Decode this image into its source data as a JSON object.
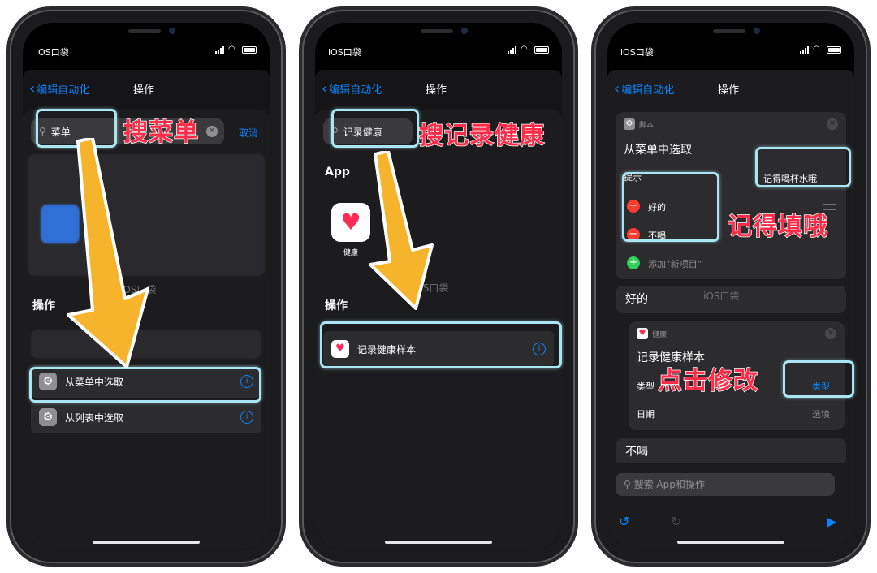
{
  "status": {
    "carrier": "iOS口袋"
  },
  "nav": {
    "back_label": "编辑自动化",
    "title": "操作"
  },
  "screen1": {
    "search_value": "菜单",
    "cancel_label": "取消",
    "watermark": "iOS口袋",
    "section_actions": "操作",
    "rows": [
      {
        "label": "从菜单中选取"
      },
      {
        "label": "从列表中选取"
      }
    ],
    "annotation": "搜菜单"
  },
  "screen2": {
    "search_value": "记录健康",
    "section_app": "App",
    "app_label": "健康",
    "watermark": "iOS口袋",
    "section_actions": "操作",
    "row_label": "记录健康样本",
    "annotation": "搜记录健康"
  },
  "screen3": {
    "card1": {
      "header": "脚本",
      "title": "从菜单中选取",
      "prompt_label": "提示",
      "prompt_value": "记得喝杯水哦",
      "items": [
        "好的",
        "不喝"
      ],
      "add_item": "添加“新项目”"
    },
    "pill1": "好的",
    "watermark": "iOS口袋",
    "card2": {
      "header": "健康",
      "title": "记录健康样本",
      "type_label": "类型",
      "type_value": "类型",
      "date_label": "日期",
      "date_value": "选填"
    },
    "pill2": "不喝",
    "bottom_search_placeholder": "搜索 App和操作",
    "annotation_fill": "记得填哦",
    "annotation_tap": "点击修改"
  },
  "colors": {
    "accent": "#0a84ff",
    "annotation": "#ff2d4a",
    "highlight": "#a9e6f2",
    "arrow": "#f6b42c"
  }
}
